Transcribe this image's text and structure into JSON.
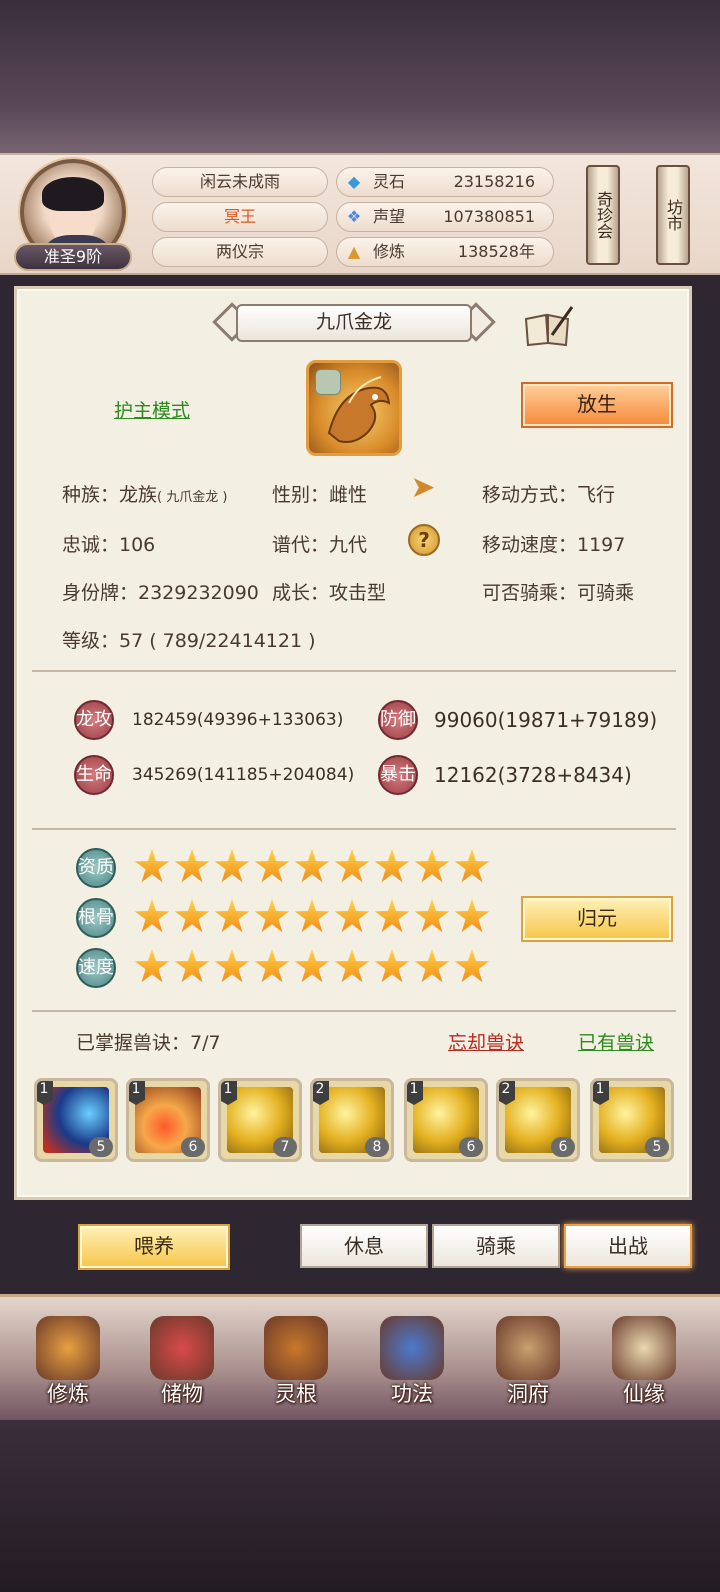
{
  "header": {
    "rank": "准圣9阶",
    "name": "闲云未成雨",
    "title": "冥王",
    "sect": "两仪宗",
    "stats": [
      {
        "icon": "spirit-stone-icon",
        "label": "灵石",
        "value": "23158216"
      },
      {
        "icon": "prestige-icon",
        "label": "声望",
        "value": "107380851"
      },
      {
        "icon": "meditation-icon",
        "label": "修炼",
        "value": "138528年"
      }
    ],
    "scroll_left": "奇珍会",
    "scroll_right": "坊市"
  },
  "pet": {
    "name": "九爪金龙",
    "mode": "护主模式",
    "release_label": "放生",
    "race_label": "种族：龙族",
    "race_sub": "( 九爪金龙 )",
    "gender": "性别：雌性",
    "move_type": "移动方式：飞行",
    "loyalty": "忠诚：106",
    "lineage": "谱代：九代",
    "move_speed": "移动速度：1197",
    "id_tag": "身份牌：2329232090",
    "growth": "成长：攻击型",
    "rideable": "可否骑乘：可骑乘",
    "level": "等级：57 ( 789/22414121 )"
  },
  "attributes": {
    "atk_label": "龙攻",
    "atk_value": "182459(49396+133063)",
    "def_label": "防御",
    "def_value": "99060(19871+79189)",
    "hp_label": "生命",
    "hp_value": "345269(141185+204084)",
    "crit_label": "暴击",
    "crit_value": "12162(3728+8434)"
  },
  "qualities": [
    {
      "label": "资质",
      "stars": 9
    },
    {
      "label": "根骨",
      "stars": 9
    },
    {
      "label": "速度",
      "stars": 9
    }
  ],
  "return_label": "归元",
  "skills": {
    "mastered": "已掌握兽诀：7/7",
    "forget": "忘却兽诀",
    "owned": "已有兽诀",
    "items": [
      {
        "level": "1",
        "count": "5"
      },
      {
        "level": "1",
        "count": "6"
      },
      {
        "level": "1",
        "count": "7"
      },
      {
        "level": "2",
        "count": "8"
      },
      {
        "level": "1",
        "count": "6"
      },
      {
        "level": "2",
        "count": "6"
      },
      {
        "level": "1",
        "count": "5"
      }
    ]
  },
  "actions": {
    "feed": "喂养",
    "rest": "休息",
    "ride": "骑乘",
    "battle": "出战"
  },
  "nav": [
    {
      "label": "修炼",
      "icon": "cultivate-icon"
    },
    {
      "label": "储物",
      "icon": "storage-bag-icon"
    },
    {
      "label": "灵根",
      "icon": "spirit-root-icon"
    },
    {
      "label": "功法",
      "icon": "manual-book-icon"
    },
    {
      "label": "洞府",
      "icon": "cave-mansion-icon"
    },
    {
      "label": "仙缘",
      "icon": "gourd-icon"
    }
  ],
  "colors": {
    "accent_orange": "#f48a3a",
    "link_green": "#2c8a20",
    "link_red": "#b82a20"
  }
}
